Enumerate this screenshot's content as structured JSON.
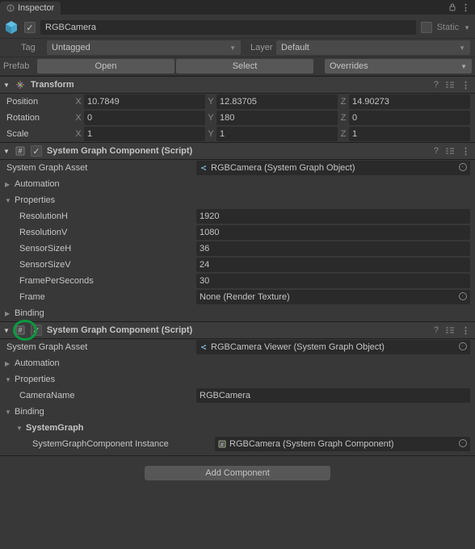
{
  "tab": {
    "title": "Inspector"
  },
  "header": {
    "name": "RGBCamera",
    "static_label": "Static",
    "static_checked": false,
    "enabled": true
  },
  "tag_row": {
    "label": "Tag",
    "value": "Untagged",
    "layer_label": "Layer",
    "layer_value": "Default"
  },
  "prefab_row": {
    "label": "Prefab",
    "open": "Open",
    "select": "Select",
    "overrides": "Overrides"
  },
  "transform": {
    "title": "Transform",
    "position": {
      "label": "Position",
      "x": "10.7849",
      "y": "12.83705",
      "z": "14.90273"
    },
    "rotation": {
      "label": "Rotation",
      "x": "0",
      "y": "180",
      "z": "0"
    },
    "scale": {
      "label": "Scale",
      "x": "1",
      "y": "1",
      "z": "1"
    }
  },
  "comp1": {
    "title": "System Graph Component (Script)",
    "enabled": true,
    "asset_label": "System Graph Asset",
    "asset_value": "RGBCamera (System Graph Object)",
    "automation_label": "Automation",
    "properties_label": "Properties",
    "props": {
      "ResolutionH": "1920",
      "ResolutionV": "1080",
      "SensorSizeH": "36",
      "SensorSizeV": "24",
      "FramePerSeconds": "30",
      "Frame": "None (Render Texture)"
    },
    "binding_label": "Binding"
  },
  "comp2": {
    "title": "System Graph Component (Script)",
    "enabled": true,
    "asset_label": "System Graph Asset",
    "asset_value": "RGBCamera Viewer (System Graph Object)",
    "automation_label": "Automation",
    "properties_label": "Properties",
    "camera_name_label": "CameraName",
    "camera_name_value": "RGBCamera",
    "binding_label": "Binding",
    "systemgraph_label": "SystemGraph",
    "sgc_instance_label": "SystemGraphComponent Instance",
    "sgc_instance_value": "RGBCamera (System Graph Component)"
  },
  "add_component": "Add Component",
  "axis": {
    "x": "X",
    "y": "Y",
    "z": "Z"
  }
}
